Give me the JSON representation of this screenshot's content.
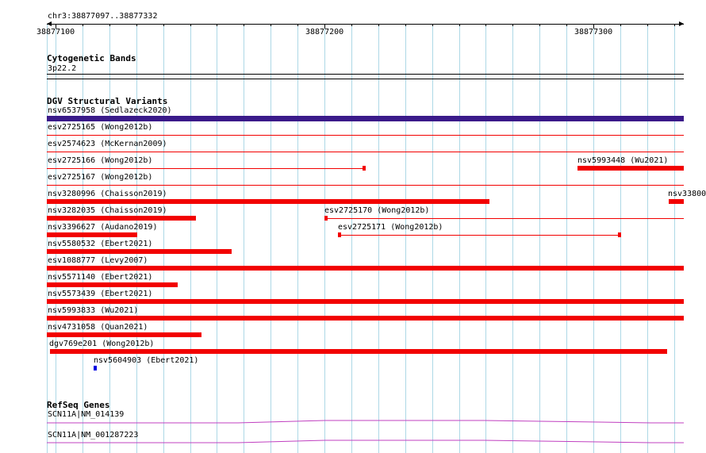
{
  "ruler": {
    "region": "chr3:38877097..38877332",
    "tick_labels": [
      "38877100",
      "38877200",
      "38877300"
    ]
  },
  "cytoband": {
    "title": "Cytogenetic Bands",
    "band": "3p22.2"
  },
  "dgv": {
    "title": "DGV Structural Variants",
    "variants": [
      {
        "label": "nsv6537958 (Sedlazeck2020)",
        "color": "#3a1a8a"
      },
      {
        "label": "esv2725165 (Wong2012b)",
        "color": "#f20000"
      },
      {
        "label": "esv2574623 (McKernan2009)",
        "color": "#f20000"
      },
      {
        "label": "esv2725166 (Wong2012b)",
        "color": "#f20000"
      },
      {
        "label": "nsv5993448 (Wu2021)",
        "color": "#f20000"
      },
      {
        "label": "esv2725167 (Wong2012b)",
        "color": "#f20000"
      },
      {
        "label": "nsv3280996 (Chaisson2019)",
        "color": "#f20000"
      },
      {
        "label": "nsv33800",
        "color": "#f20000"
      },
      {
        "label": "nsv3282035 (Chaisson2019)",
        "color": "#f20000"
      },
      {
        "label": "esv2725170 (Wong2012b)",
        "color": "#f20000"
      },
      {
        "label": "nsv3396627 (Audano2019)",
        "color": "#f20000"
      },
      {
        "label": "esv2725171 (Wong2012b)",
        "color": "#f20000"
      },
      {
        "label": "nsv5580532 (Ebert2021)",
        "color": "#f20000"
      },
      {
        "label": "esv1088777 (Levy2007)",
        "color": "#f20000"
      },
      {
        "label": "nsv5571140 (Ebert2021)",
        "color": "#f20000"
      },
      {
        "label": "nsv5573439 (Ebert2021)",
        "color": "#f20000"
      },
      {
        "label": "nsv5993833 (Wu2021)",
        "color": "#f20000"
      },
      {
        "label": "nsv4731058 (Quan2021)",
        "color": "#f20000"
      },
      {
        "label": "dgv769e201 (Wong2012b)",
        "color": "#f20000"
      },
      {
        "label": "nsv5604903 (Ebert2021)",
        "color": "#0000e0"
      }
    ]
  },
  "refseq": {
    "title": "RefSeq Genes",
    "genes": [
      {
        "label": "SCN11A|NM_014139",
        "color": "#c040c0"
      },
      {
        "label": "SCN11A|NM_001287223",
        "color": "#c040c0"
      }
    ]
  }
}
